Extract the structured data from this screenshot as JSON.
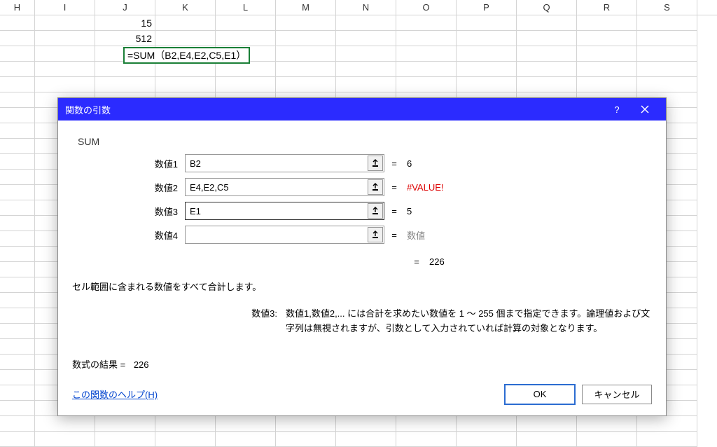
{
  "columns": [
    "H",
    "I",
    "J",
    "K",
    "L",
    "M",
    "N",
    "O",
    "P",
    "Q",
    "R",
    "S"
  ],
  "cells": {
    "j1": "15",
    "j2": "512",
    "j3_formula": "=SUM（B2,E4,E2,C5,E1）"
  },
  "dialog": {
    "title": "関数の引数",
    "func_name": "SUM",
    "args": [
      {
        "label": "数値1",
        "value": "B2",
        "result": "6",
        "error": false,
        "placeholder": false
      },
      {
        "label": "数値2",
        "value": "E4,E2,C5",
        "result": "#VALUE!",
        "error": true,
        "placeholder": false
      },
      {
        "label": "数値3",
        "value": "E1",
        "result": "5",
        "error": false,
        "placeholder": false
      },
      {
        "label": "数値4",
        "value": "",
        "result": "数値",
        "error": false,
        "placeholder": true
      }
    ],
    "total_result": "226",
    "desc_main": "セル範囲に含まれる数値をすべて合計します。",
    "arg_desc_label": "数値3:",
    "arg_desc_text": "数値1,数値2,... には合計を求めたい数値を 1 ～ 255 個まで指定できます。論理値および文字列は無視されますが、引数として入力されていれば計算の対象となります。",
    "result_label": "数式の結果 = ",
    "result_value": "226",
    "help_link": "この関数のヘルプ(H)",
    "ok": "OK",
    "cancel": "キャンセル"
  }
}
